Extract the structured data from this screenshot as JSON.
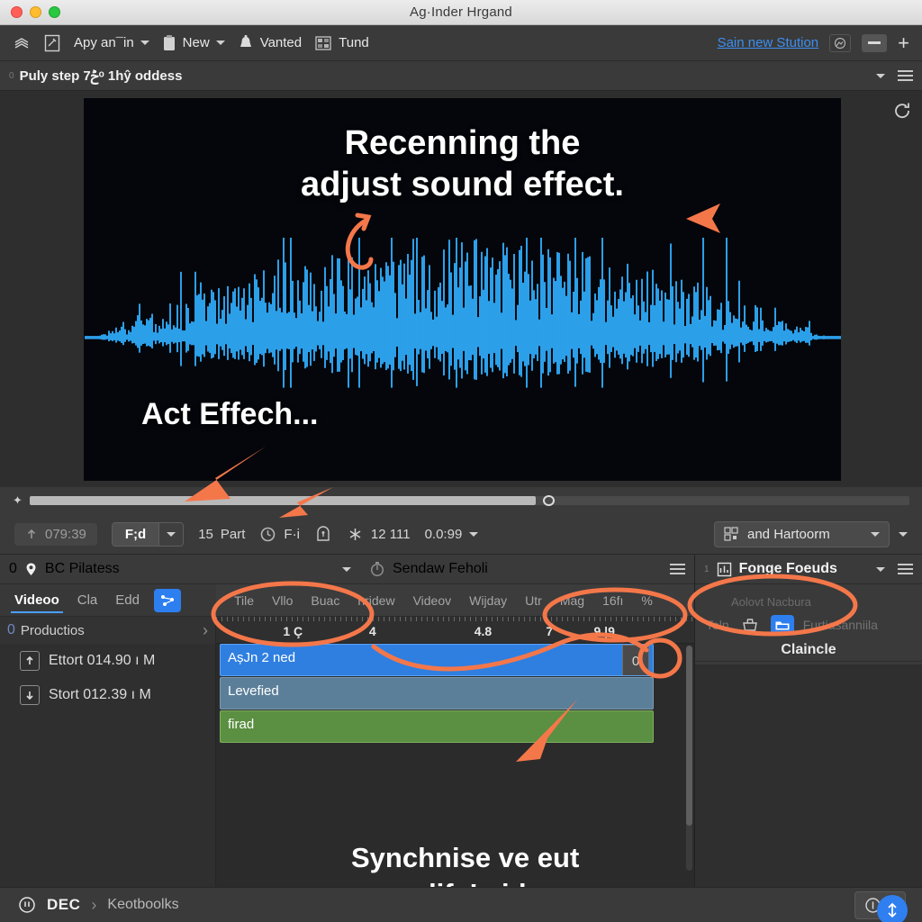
{
  "window": {
    "title": "Ag·Inder Hrgand",
    "traffic_lights": [
      "close",
      "minimize",
      "maximize"
    ]
  },
  "toolbar": {
    "items": [
      {
        "icon": "layers-icon",
        "label": ""
      },
      {
        "icon": "edit-image-icon",
        "label": ""
      },
      {
        "icon": "",
        "label": "Apy an¯in",
        "caret": true
      },
      {
        "icon": "clipboard-icon",
        "label": "New",
        "caret": true
      },
      {
        "icon": "bell-icon",
        "label": "Vanted",
        "caret": false
      },
      {
        "icon": "grid-image-icon",
        "label": "Tund",
        "caret": false
      }
    ],
    "link_label": "Sain new  Stution",
    "right_icons": [
      "image-icon",
      "minimize-icon",
      "plus-icon"
    ]
  },
  "subbar": {
    "index": "0",
    "title": "Puly step ݲ7ᵒ  1hŷ oddess",
    "caret": "chevron-down-icon",
    "menu": "hamburger-icon"
  },
  "preview": {
    "overlay_title_line1": "Recenning the",
    "overlay_title_line2": "adjust sound effect.",
    "overlay_subtitle": "Act Effech...",
    "refresh_icon": "refresh-icon",
    "waveform_color": "#2fa8f5",
    "background": "#05060b"
  },
  "scrub": {
    "keyframe_icon": "keyframe-diamond-icon",
    "fill_percent": 57.5,
    "knob_percent": 58.3
  },
  "options_bar": {
    "timecode": "079:39",
    "upload_icon": "upload-icon",
    "segment_label": "F;d",
    "segment_caret": "chevron-down-icon",
    "part_count": "15",
    "part_label": "Part",
    "clock_icon": "clock-icon",
    "clock_label": "F·i",
    "arch_icon": "arch-icon",
    "star_icon": "asterisk-icon",
    "star_value": "12 111",
    "duration": "0.0:99",
    "duration_caret": "chevron-down-icon",
    "dropdown": {
      "icon": "qr-icon",
      "value": "and Hartoorm",
      "caret": "chevron-down-icon"
    },
    "extra_caret": "chevron-down-icon"
  },
  "left_panel": {
    "header": {
      "index": "0",
      "pin_icon": "location-pin-icon",
      "title": "BC Pilatess",
      "caret": "chevron-down-icon"
    },
    "secondary_header": {
      "icon": "stopwatch-icon",
      "title": "Sendaw Feholi",
      "menu": "hamburger-icon"
    },
    "tabs": [
      {
        "label": "Videoo",
        "active": true
      },
      {
        "label": "Cla",
        "active": false
      },
      {
        "label": "Edd",
        "active": false
      }
    ],
    "tab_action_icon": "node-graph-icon",
    "timeline_menu": [
      "Tile",
      "Vllo",
      "Buac",
      "hridew",
      "Videov",
      "Wijday",
      "Utr",
      "Mag",
      "16fı"
    ],
    "timeline_menu_end_icon": "percent-icon",
    "ruler_labels": [
      {
        "text": "1 Ç",
        "pos": 14
      },
      {
        "text": "4",
        "pos": 32
      },
      {
        "text": "4.8",
        "pos": 54
      },
      {
        "text": "7",
        "pos": 69
      },
      {
        "text": "9 |9",
        "pos": 79
      }
    ],
    "track_header": {
      "index": "0",
      "label": "Productios",
      "chevron": "chevron-right-icon"
    },
    "track_rows": [
      {
        "badge": "export-icon",
        "label": "Ettort 014.90 ı M"
      },
      {
        "badge": "import-icon",
        "label": "Stort 012.39 ı M"
      }
    ],
    "clips": [
      {
        "label": "AșJn 2 ned",
        "color": "#2f7fe0",
        "type": "blue"
      },
      {
        "label": "Levefied",
        "color": "#5c7f99",
        "type": "slate"
      },
      {
        "label": "firad",
        "color": "#5b8f42",
        "type": "green"
      }
    ],
    "clip_handle_label": "0",
    "overlay_line1": "Synchnise ve eut",
    "overlay_line2": "noundify! video."
  },
  "right_panel": {
    "index": "1",
    "icon": "chart-icon",
    "title": "Fonge Foeuds",
    "caret": "chevron-down-icon",
    "menu": "hamburger-icon",
    "ghost_label": "Aolovt Nacbura",
    "row": {
      "left_label": "Toln",
      "basket_icon": "basket-icon",
      "folder_icon": "folder-icon",
      "right_label": "Furtiasanniila"
    },
    "subtitle": "Claincle"
  },
  "statusbar": {
    "power_icon": "power-icon",
    "label": "DEC",
    "separator": "chevron-right-icon",
    "breadcrumb": "Keotboolks",
    "button_icon": "info-icon",
    "button_caret": "chevron-down-icon",
    "fab_icon": "anchor-icon"
  },
  "colors": {
    "accent_blue": "#2d7ff0",
    "link_blue": "#3c8ff0",
    "annotation_orange": "#f4774a",
    "waveform_blue": "#2fa8f5",
    "clip_blue": "#2f7fe0",
    "clip_slate": "#5c7f99",
    "clip_green": "#5b8f42",
    "panel_bg": "#3a3a3a",
    "canvas_bg": "#05060b"
  }
}
